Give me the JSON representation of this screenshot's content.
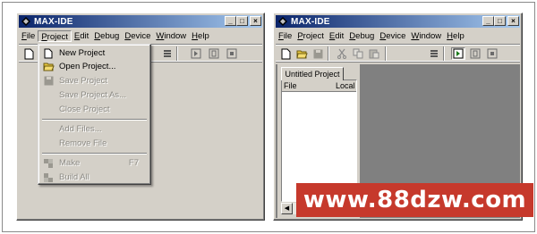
{
  "left_window": {
    "title": "MAX-IDE",
    "controls": {
      "minimize": "_",
      "maximize": "□",
      "close": "×"
    },
    "menu": [
      {
        "label": "File",
        "mnemonic": "F",
        "rest": "ile"
      },
      {
        "label": "Project",
        "mnemonic": "P",
        "rest": "roject"
      },
      {
        "label": "Edit",
        "mnemonic": "E",
        "rest": "dit"
      },
      {
        "label": "Debug",
        "mnemonic": "D",
        "rest": "ebug"
      },
      {
        "label": "Device",
        "mnemonic": "D",
        "rest": "evice"
      },
      {
        "label": "Window",
        "mnemonic": "W",
        "rest": "indow"
      },
      {
        "label": "Help",
        "mnemonic": "H",
        "rest": "elp"
      }
    ],
    "project_menu": {
      "new_project": "New Project",
      "open_project": "Open Project...",
      "save_project": "Save Project",
      "save_project_as": "Save Project As...",
      "close_project": "Close Project",
      "add_files": "Add Files...",
      "remove_file": "Remove File",
      "make": "Make",
      "make_accel": "F7",
      "build_all": "Build All"
    }
  },
  "right_window": {
    "title": "MAX-IDE",
    "controls": {
      "minimize": "_",
      "maximize": "□",
      "close": "×"
    },
    "menu": [
      {
        "label": "File",
        "mnemonic": "F",
        "rest": "ile"
      },
      {
        "label": "Project",
        "mnemonic": "P",
        "rest": "roject"
      },
      {
        "label": "Edit",
        "mnemonic": "E",
        "rest": "dit"
      },
      {
        "label": "Debug",
        "mnemonic": "D",
        "rest": "ebug"
      },
      {
        "label": "Device",
        "mnemonic": "D",
        "rest": "evice"
      },
      {
        "label": "Window",
        "mnemonic": "W",
        "rest": "indow"
      },
      {
        "label": "Help",
        "mnemonic": "H",
        "rest": "elp"
      }
    ],
    "workspace": {
      "tab": "Untitled Project",
      "columns": [
        "File",
        "Local"
      ]
    }
  },
  "watermark": {
    "text": "www.88dzw.com"
  },
  "colors": {
    "titlebar_start": "#0a246a",
    "titlebar_end": "#a6caf0",
    "face": "#d4d0c8",
    "watermark_bg": "#c6392c"
  }
}
